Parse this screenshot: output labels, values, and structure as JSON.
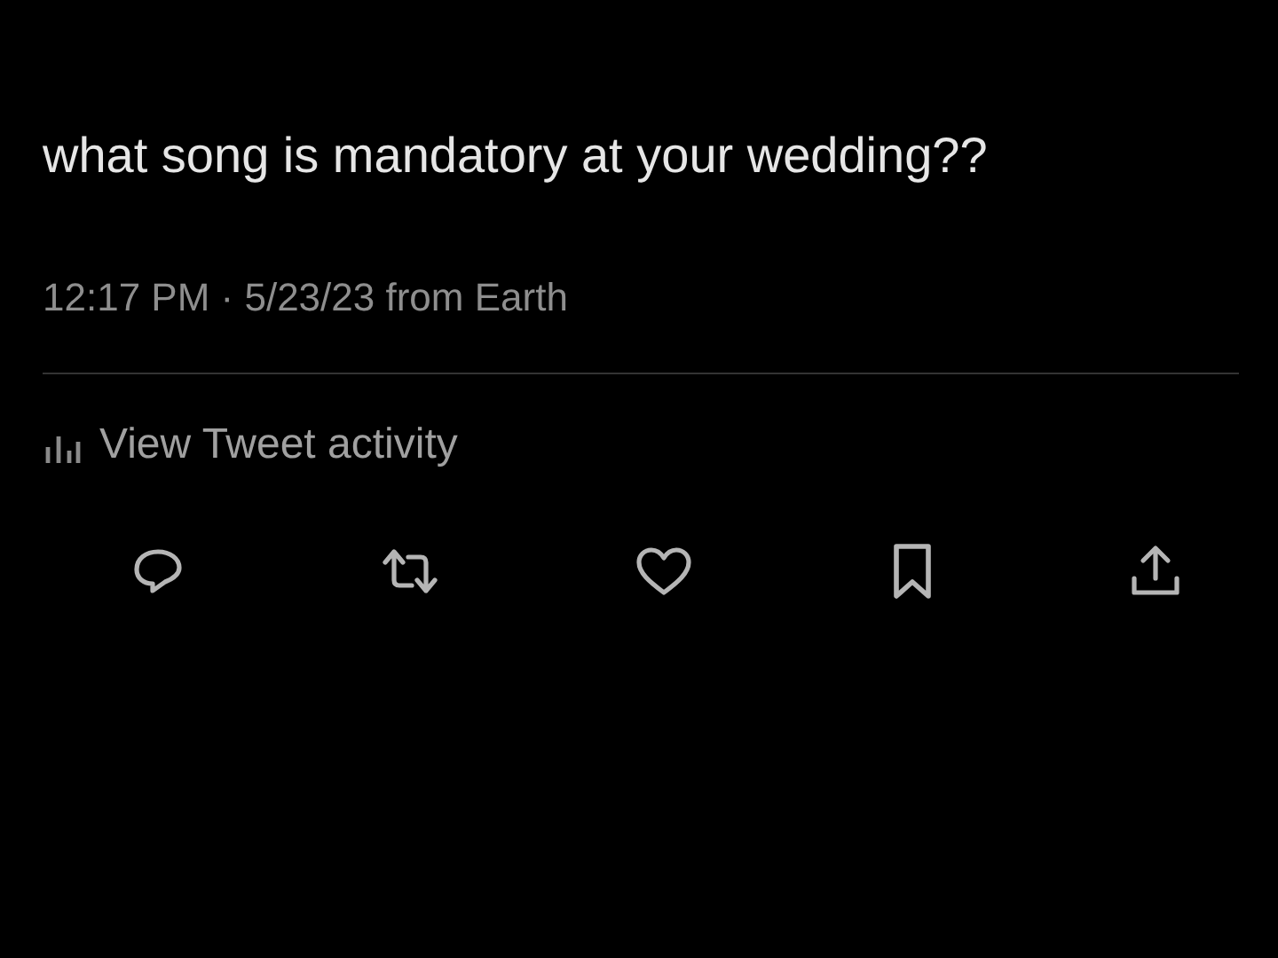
{
  "tweet": {
    "text": "what song is mandatory at your wedding??",
    "timestamp": "12:17 PM · 5/23/23 from Earth"
  },
  "activity_link": {
    "label": "View Tweet activity"
  },
  "actions": [
    {
      "kind": "reply"
    },
    {
      "kind": "retweet"
    },
    {
      "kind": "like"
    },
    {
      "kind": "bookmark"
    },
    {
      "kind": "share"
    }
  ]
}
